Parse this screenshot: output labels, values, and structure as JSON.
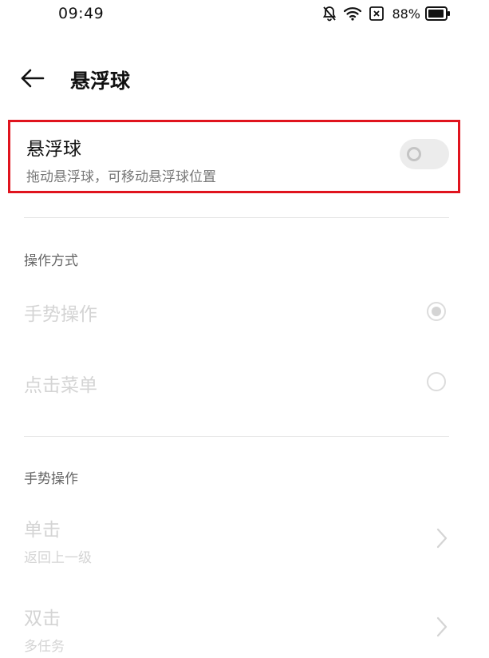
{
  "status_bar": {
    "time": "09:49",
    "battery": "88%"
  },
  "header": {
    "title": "悬浮球"
  },
  "float_ball": {
    "title": "悬浮球",
    "subtitle": "拖动悬浮球，可移动悬浮球位置",
    "enabled": false
  },
  "operation_mode": {
    "header": "操作方式",
    "options": [
      {
        "label": "手势操作",
        "selected": true
      },
      {
        "label": "点击菜单",
        "selected": false
      }
    ]
  },
  "gesture_ops": {
    "header": "手势操作",
    "items": [
      {
        "label": "单击",
        "sub": "返回上一级"
      },
      {
        "label": "双击",
        "sub": "多任务"
      }
    ]
  },
  "colors": {
    "highlight_border": "#e0141e",
    "disabled_text": "#d4d4d4",
    "toggle_off": "#ececec"
  }
}
